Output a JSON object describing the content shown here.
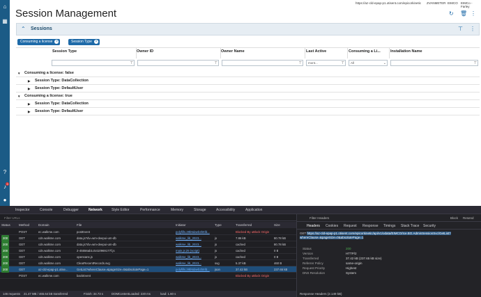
{
  "topbar": {
    "url": "https://az-cld-epap-p1.otisent.com/epicorkinetic",
    "user": "ZVANMETER",
    "company": "EIMCO",
    "site": "EIMCo - Farley"
  },
  "page": {
    "title": "Session Management"
  },
  "panel": {
    "title": "Sessions"
  },
  "chips": [
    "Consuming a license",
    "Session Type"
  ],
  "grid": {
    "columns": [
      "Session Type",
      "Owner ID",
      "Owner Name",
      "Last Active",
      "Consuming a Li...",
      "Installation Name"
    ],
    "filters": {
      "last_active": "mont...",
      "consuming": "All"
    },
    "groups": [
      {
        "label": "Consuming a license: false",
        "children": [
          "Session Type: DataCollection",
          "Session Type: DefaultUser"
        ]
      },
      {
        "label": "Consuming a license: true",
        "children": [
          "Session Type: DataCollection",
          "Session Type: DefaultUser"
        ]
      }
    ]
  },
  "left_badge": "3",
  "devtools": {
    "tabs": [
      "Inspector",
      "Console",
      "Debugger",
      "Network",
      "Style Editor",
      "Performance",
      "Memory",
      "Storage",
      "Accessibility",
      "Application"
    ],
    "filter_placeholder": "Filter URLs",
    "columns": [
      "Status",
      "Method",
      "Domain",
      "File",
      "Initiator",
      "Type",
      "Transferred",
      "Size"
    ],
    "rows": [
      {
        "status": "",
        "method": "POST",
        "domain": "ec.walkme.com",
        "file": "postEvent",
        "initiator": "polyfills.28b5daeb2b5fd...",
        "type": "",
        "transferred": "Blocked By uBlock Origin",
        "size": ""
      },
      {
        "status": "200",
        "method": "GET",
        "domain": "cdn.walkme.com",
        "file": "data.js?dv=wm-deepui-um-db",
        "initiator": "walkme_lib_2023...",
        "type": "js",
        "transferred": "7.86 kB",
        "size": "80.78 kB"
      },
      {
        "status": "200",
        "method": "GET",
        "domain": "cdn.walkme.com",
        "file": "data.js?dv=wm-deepui-um-db",
        "initiator": "walkme_lib_2023...",
        "type": "js",
        "transferred": "cached",
        "size": "80.78 kB"
      },
      {
        "status": "200",
        "method": "GET",
        "domain": "cdn.walkme.com",
        "file": "2-45556ab1c5410969177f.js",
        "initiator": "main.js:25 (script)",
        "type": "js",
        "transferred": "cached",
        "size": "0 B"
      },
      {
        "status": "200",
        "method": "GET",
        "domain": "cdn.walkme.com",
        "file": "opensans.js",
        "initiator": "walkme_lib_2023...",
        "type": "js",
        "transferred": "cached",
        "size": "0 B"
      },
      {
        "status": "200",
        "method": "GET",
        "domain": "cdn.walkme.com",
        "file": "ClearRecentRecords.svg",
        "initiator": "walkme_lib_2023...",
        "type": "svg",
        "transferred": "5.37 kB",
        "size": "460 B"
      },
      {
        "status": "200",
        "method": "GET",
        "domain": "az-cld-epap-p1.otise...",
        "file": "GetList?whereClause=&pageSize=0&absolutePage=1",
        "initiator": "polyfills.28b5daeb2b5fd...",
        "type": "json",
        "transferred": "37.42 kB",
        "size": "237.65 kB"
      },
      {
        "status": "",
        "method": "POST",
        "domain": "ec.walkme.com",
        "file": "backEvent",
        "initiator": "",
        "type": "",
        "transferred": "Blocked By uBlock Origin",
        "size": ""
      }
    ],
    "status_bar": {
      "requests": "146 requests",
      "transferred": "21.47 MB / 465.64 kB transferred",
      "finish": "Finish: 34.73 s",
      "dcl": "DOMContentLoaded: 220 ms",
      "load": "load: 1.60 s"
    },
    "side_tabs": [
      "Headers",
      "Cookies",
      "Request",
      "Response",
      "Timings",
      "Stack Trace",
      "Security"
    ],
    "side_top": {
      "filter": "Filter Headers",
      "block": "Block",
      "resend": "Resend"
    },
    "request": {
      "method": "GET",
      "url": "https://az-cld-epap-p1.otisent.com/epicorkinetic/api/v1/odata/EIMCO/Ice.BO.AdminSessionSvc/GetList?whereClause=&pageSize=0&absolutePage=1"
    },
    "details": [
      {
        "k": "Status",
        "v": "200"
      },
      {
        "k": "Version",
        "v": "HTTP/2"
      },
      {
        "k": "Transferred",
        "v": "37.42 kB (237.65 kB size)"
      },
      {
        "k": "Referrer Policy",
        "v": "same-origin"
      },
      {
        "k": "Request Priority",
        "v": "Highest"
      },
      {
        "k": "DNS Resolution",
        "v": "System"
      }
    ],
    "response_headers": "Response Headers (2.149 kB)"
  },
  "colors": {
    "accent": "#1e6aa8",
    "nav": "#1b5b86",
    "dark": "#1f1f23"
  }
}
